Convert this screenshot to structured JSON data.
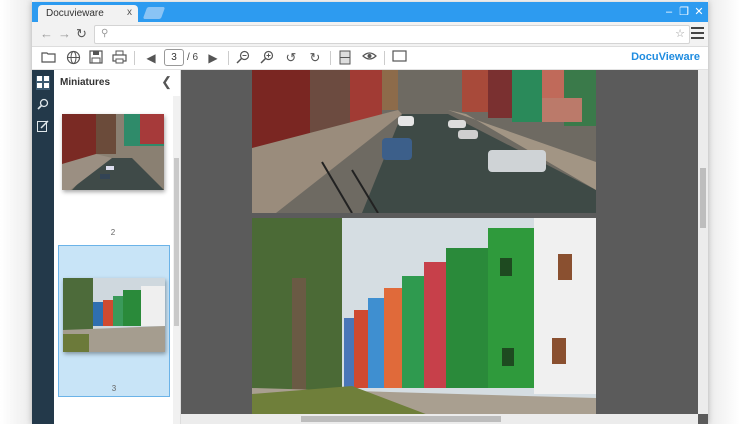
{
  "browser": {
    "tab_title": "Docuvieware",
    "tab_close": "x",
    "url_placeholder": "",
    "window_controls": {
      "minimize": "–",
      "restore": "❐",
      "close": "✕"
    }
  },
  "toolbar": {
    "current_page": "3",
    "page_total": "/ 6",
    "brand": "DocuVieware"
  },
  "sidebar": {
    "title": "Miniatures",
    "thumbnails": [
      {
        "label": "2",
        "selected": false
      },
      {
        "label": "3",
        "selected": true
      }
    ]
  },
  "colors": {
    "titlebar": "#2d9bf0",
    "rail": "#23394a",
    "viewer_background": "#5b5b5b",
    "selected_thumb": "#c8e4f7",
    "brand": "#1f8ce0"
  },
  "icons": {
    "open": "folder-open-icon",
    "web": "globe-icon",
    "save": "floppy-icon",
    "print": "printer-icon",
    "prev": "arrow-left-icon",
    "next": "arrow-right-icon",
    "zoom_out": "zoom-out-icon",
    "zoom_in": "zoom-in-icon",
    "rotate_left": "rotate-left-icon",
    "rotate_right": "rotate-right-icon",
    "fit": "fit-page-icon",
    "view": "eye-icon",
    "fullscreen": "rectangle-icon"
  }
}
